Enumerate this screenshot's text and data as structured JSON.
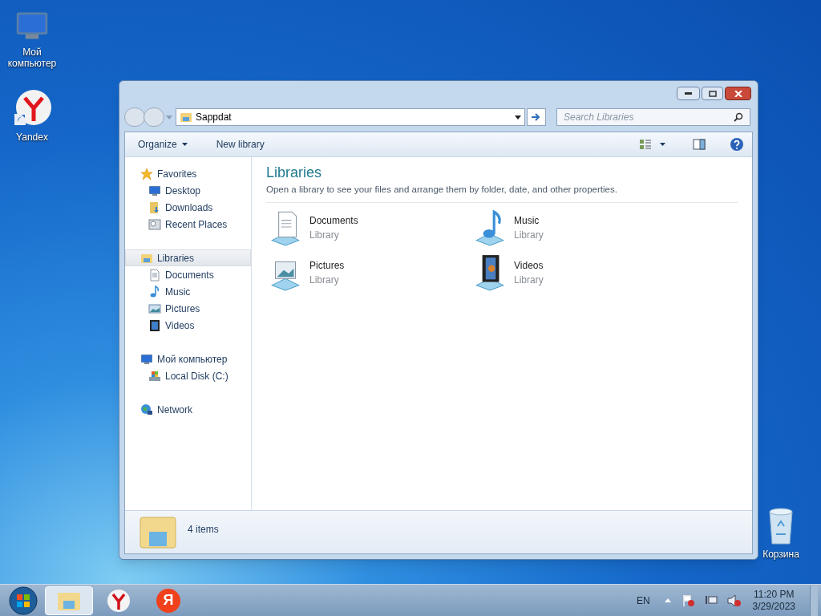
{
  "desktop_icons": [
    {
      "label": "Мой компьютер"
    },
    {
      "label": "Yandex"
    },
    {
      "label": "Корзина"
    }
  ],
  "window": {
    "address": "Sappdat",
    "search_placeholder": "Search Libraries",
    "toolbar": [
      {
        "label": "Organize",
        "menu": true
      },
      {
        "label": "New library",
        "menu": false
      }
    ],
    "sidebar": [
      {
        "label": "Favorites",
        "selected": false,
        "children": [
          {
            "label": "Desktop",
            "selected": false
          },
          {
            "label": "Downloads",
            "selected": false
          },
          {
            "label": "Recent Places",
            "selected": false
          }
        ]
      },
      {
        "label": "Libraries",
        "selected": true,
        "children": [
          {
            "label": "Documents",
            "selected": false
          },
          {
            "label": "Music",
            "selected": false
          },
          {
            "label": "Pictures",
            "selected": false
          },
          {
            "label": "Videos",
            "selected": false
          }
        ]
      },
      {
        "label": "Мой компьютер",
        "selected": false,
        "children": [
          {
            "label": "Local Disk (C:)",
            "selected": false
          }
        ]
      },
      {
        "label": "Network",
        "selected": false
      }
    ],
    "content": {
      "title": "Libraries",
      "description": "Open a library to see your files and arrange them by folder, date, and other properties.",
      "items": [
        {
          "name": "Documents",
          "type": "Library"
        },
        {
          "name": "Music",
          "type": "Library"
        },
        {
          "name": "Pictures",
          "type": "Library"
        },
        {
          "name": "Videos",
          "type": "Library"
        }
      ]
    },
    "status": "4 items"
  },
  "taskbar": {
    "items": [
      {
        "kind": "explorer",
        "selected": true
      },
      {
        "kind": "browser",
        "selected": false
      },
      {
        "kind": "yandex",
        "label": "Я",
        "selected": false
      }
    ],
    "language": "EN",
    "time": "11:20 PM",
    "date": "3/29/2023"
  }
}
